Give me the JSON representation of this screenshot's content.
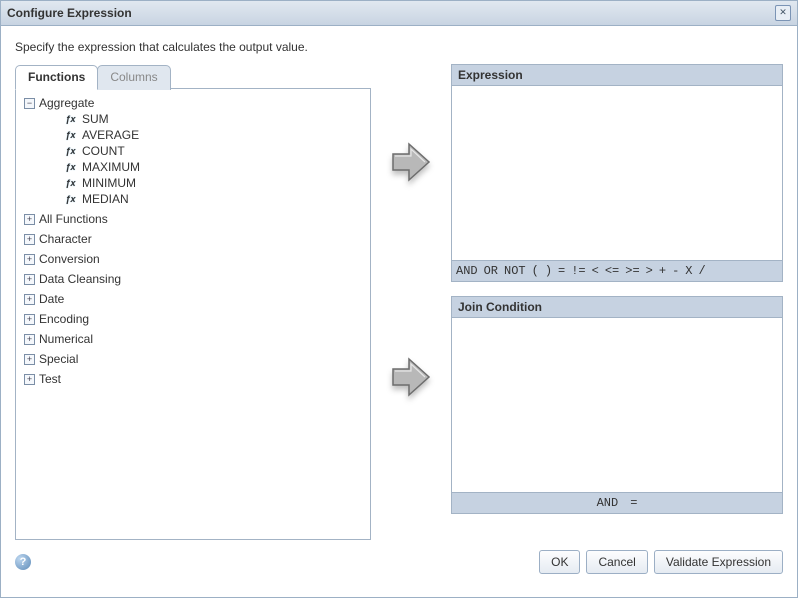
{
  "dialog": {
    "title": "Configure Expression",
    "instruction": "Specify the expression that calculates the output value."
  },
  "tabs": {
    "functions": "Functions",
    "columns": "Columns",
    "active": "functions"
  },
  "categories": [
    {
      "label": "Aggregate",
      "expanded": true,
      "functions": [
        "SUM",
        "AVERAGE",
        "COUNT",
        "MAXIMUM",
        "MINIMUM",
        "MEDIAN"
      ]
    },
    {
      "label": "All Functions",
      "expanded": false
    },
    {
      "label": "Character",
      "expanded": false
    },
    {
      "label": "Conversion",
      "expanded": false
    },
    {
      "label": "Data Cleansing",
      "expanded": false
    },
    {
      "label": "Date",
      "expanded": false
    },
    {
      "label": "Encoding",
      "expanded": false
    },
    {
      "label": "Numerical",
      "expanded": false
    },
    {
      "label": "Special",
      "expanded": false
    },
    {
      "label": "Test",
      "expanded": false
    }
  ],
  "panels": {
    "expression": {
      "title": "Expression",
      "value": ""
    },
    "join": {
      "title": "Join Condition",
      "value": ""
    }
  },
  "expr_ops": [
    "AND",
    "OR",
    "NOT",
    "(",
    ")",
    "=",
    "!=",
    "<",
    "<=",
    ">=",
    ">",
    "+",
    "-",
    "X",
    "/"
  ],
  "join_ops": [
    "AND",
    "="
  ],
  "buttons": {
    "ok": "OK",
    "cancel": "Cancel",
    "validate": "Validate Expression"
  }
}
